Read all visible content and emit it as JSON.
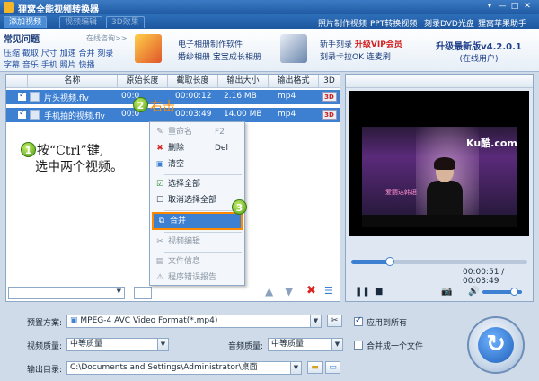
{
  "window": {
    "title": "狸窝全能视频转换器",
    "controls": [
      "▾",
      "—",
      "□",
      "✕"
    ]
  },
  "toolbar": {
    "tabs": [
      "添加视频",
      "视频编辑",
      "3D效果"
    ],
    "links": [
      "照片制作视频",
      "PPT转换视频",
      "刻录DVD光盘",
      "狸窝苹果助手"
    ]
  },
  "banner": {
    "faq_title": "常见问题",
    "faq_more": "在线咨询>>",
    "faq_line1": "压缩 截取 尺寸 加速 合并 刻录",
    "faq_line2": "字幕 音乐 手机 照片 快播",
    "promo1_line1": "电子相册制作软件",
    "promo1_line2": "婚纱相册 宝宝成长相册",
    "promo2_line1a": "新手刻录",
    "promo2_vip": "升级VIP会员",
    "promo2_line2": "刻录卡拉OK 连麦刷",
    "version": "升级最新版v4.2.0.1",
    "version_sub": "(在线用户)"
  },
  "filelist": {
    "headers": [
      "名称",
      "原始长度",
      "截取长度",
      "输出大小",
      "输出格式",
      "3D"
    ],
    "rows": [
      {
        "name": "片头视频.flv",
        "orig": "00:0",
        "cut": "00:00:12",
        "size": "2.16 MB",
        "format": "mp4",
        "badge": "3D"
      },
      {
        "name": "手机拍的视频.flv",
        "orig": "00:0",
        "cut": "00:03:49",
        "size": "14.00 MB",
        "format": "mp4",
        "badge": "3D"
      }
    ]
  },
  "annotations": {
    "step1_num": "1",
    "step1_line1": "按“Ctrl”键,",
    "step1_line2": "选中两个视频。",
    "step2_num": "2",
    "step2_text": "右击",
    "step3_num": "3"
  },
  "context_menu": {
    "items": [
      {
        "label": "重命名",
        "shortcut": "F2",
        "icon": "rename-icon",
        "glyph": "✎",
        "disabled": true
      },
      {
        "label": "删除",
        "shortcut": "Del",
        "icon": "delete-icon",
        "glyph": "✖",
        "disabled": false
      },
      {
        "label": "清空",
        "shortcut": "",
        "icon": "clear-icon",
        "glyph": "▣",
        "disabled": false
      },
      {
        "label": "选择全部",
        "shortcut": "",
        "icon": "select-all-icon",
        "glyph": "☑",
        "disabled": false
      },
      {
        "label": "取消选择全部",
        "shortcut": "",
        "icon": "deselect-all-icon",
        "glyph": "☐",
        "disabled": false
      },
      {
        "label": "合并",
        "shortcut": "",
        "icon": "merge-icon",
        "glyph": "⧉",
        "disabled": false,
        "highlighted": true
      },
      {
        "label": "视频编辑",
        "shortcut": "",
        "icon": "edit-video-icon",
        "glyph": "✂",
        "disabled": true
      },
      {
        "label": "文件信息",
        "shortcut": "",
        "icon": "file-info-icon",
        "glyph": "▤",
        "disabled": true
      },
      {
        "label": "程序错误报告",
        "shortcut": "",
        "icon": "error-report-icon",
        "glyph": "⚠",
        "disabled": true
      }
    ]
  },
  "preview": {
    "watermark": "Ku酷.com",
    "caption": "爱丽达韩语",
    "progress": 0.22,
    "time": "00:00:51 / 00:03:49",
    "volume": 0.8
  },
  "settings": {
    "preset_label": "预置方案:",
    "preset_value": "MPEG-4 AVC Video Format(*.mp4)",
    "apply_all_label": "应用到所有",
    "apply_all_checked": true,
    "video_quality_label": "视频质量:",
    "video_quality_value": "中等质量",
    "audio_quality_label": "音频质量:",
    "audio_quality_value": "中等质量",
    "merge_label": "合并成一个文件",
    "merge_checked": false,
    "output_label": "输出目录:",
    "output_value": "C:\\Documents and Settings\\Administrator\\桌面"
  },
  "colors": {
    "accent": "#3d7fd1",
    "highlight_border": "#ff8a00",
    "annotation_green": "#4e9d17"
  }
}
